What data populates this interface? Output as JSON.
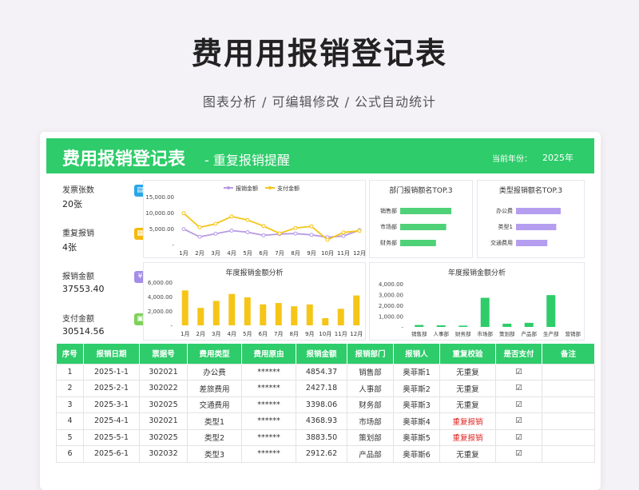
{
  "hero": {
    "title": "费用用报销登记表",
    "subtitle": "图表分析 /  可编辑修改  /  公式自动统计"
  },
  "header": {
    "title": "费用报销登记表",
    "subtitle": "- 重复报销提醒",
    "year_label": "当前年份：",
    "year_value": "2025年"
  },
  "kpis": [
    {
      "label": "发票张数",
      "value": "20张",
      "icon": "doc-icon",
      "color": "#29a6e8",
      "glyph": "▤"
    },
    {
      "label": "重复报销",
      "value": "4张",
      "icon": "repeat-icon",
      "color": "#f5b90f",
      "glyph": "▦"
    },
    {
      "label": "报销金额",
      "value": "37553.40",
      "icon": "yen-icon",
      "color": "#a48ee8",
      "glyph": "¥"
    },
    {
      "label": "支付金额",
      "value": "30514.56",
      "icon": "pay-icon",
      "color": "#7fd15a",
      "glyph": "▣"
    }
  ],
  "chart_data": [
    {
      "type": "line",
      "legend": [
        "报销金额",
        "支付金额"
      ],
      "categories": [
        "1月",
        "2月",
        "3月",
        "4月",
        "5月",
        "6月",
        "7月",
        "8月",
        "9月",
        "10月",
        "11月",
        "12月"
      ],
      "series": [
        {
          "name": "报销金额",
          "values": [
            4854,
            2428,
            3398,
            4369,
            3884,
            2913,
            3300,
            3450,
            3050,
            2300,
            2700,
            4500
          ],
          "color": "#b79ae3"
        },
        {
          "name": "支付金额",
          "values": [
            9800,
            5400,
            6500,
            8800,
            7700,
            5800,
            3500,
            5200,
            5700,
            1500,
            3800,
            4300
          ],
          "color": "#f5c518"
        }
      ],
      "yticks": [
        "15,000.00",
        "10,000.00",
        "5,000.00",
        "-"
      ],
      "ylim": [
        0,
        15000
      ]
    },
    {
      "type": "bar",
      "title": "年度报销金额分析",
      "categories": [
        "1月",
        "2月",
        "3月",
        "4月",
        "5月",
        "6月",
        "7月",
        "8月",
        "9月",
        "10月",
        "11月",
        "12月"
      ],
      "values": [
        4854,
        2428,
        3398,
        4369,
        3884,
        2913,
        3100,
        2650,
        2900,
        1000,
        2300,
        4150
      ],
      "yticks": [
        "6,000.00",
        "4,000.00",
        "2,000.00",
        "-"
      ],
      "ylim": [
        0,
        6000
      ],
      "color": "#f5c518"
    },
    {
      "type": "bar",
      "title": "部门报销额名TOP.3",
      "orientation": "horizontal",
      "categories": [
        "销售部",
        "市场部",
        "财务部"
      ],
      "values": [
        4854,
        4369,
        3398
      ],
      "color": "#4fd178"
    },
    {
      "type": "bar",
      "title": "类型报销额名TOP.3",
      "orientation": "horizontal",
      "categories": [
        "办公费",
        "类型1",
        "交通费用"
      ],
      "values": [
        4854,
        4369,
        3398
      ],
      "color": "#b59ef0"
    },
    {
      "type": "bar",
      "title": "年度报销金额分析",
      "categories": [
        "销售部",
        "人事部",
        "财务部",
        "市场部",
        "策划部",
        "产品部",
        "生产部",
        "营销部"
      ],
      "values": [
        180,
        150,
        120,
        2700,
        300,
        380,
        2950,
        0
      ],
      "yticks": [
        "4,000.00",
        "3,000.00",
        "2,000.00",
        "1,000.00",
        "-"
      ],
      "ylim": [
        0,
        4000
      ],
      "color": "#2ecc6a"
    }
  ],
  "table": {
    "headers": [
      "序号",
      "报销日期",
      "票据号",
      "费用类型",
      "费用原由",
      "报销金额",
      "报销部门",
      "报销人",
      "重复校验",
      "是否支付",
      "备注"
    ],
    "rows": [
      [
        "1",
        "2025-1-1",
        "302021",
        "办公费",
        "******",
        "4854.37",
        "销售部",
        "奥菲斯1",
        "无重复",
        "☑",
        ""
      ],
      [
        "2",
        "2025-2-1",
        "302022",
        "差旅费用",
        "******",
        "2427.18",
        "人事部",
        "奥菲斯2",
        "无重复",
        "☑",
        ""
      ],
      [
        "3",
        "2025-3-1",
        "302025",
        "交通费用",
        "******",
        "3398.06",
        "财务部",
        "奥菲斯3",
        "无重复",
        "☑",
        ""
      ],
      [
        "4",
        "2025-4-1",
        "302021",
        "类型1",
        "******",
        "4368.93",
        "市场部",
        "奥菲斯4",
        "重复报销",
        "☑",
        ""
      ],
      [
        "5",
        "2025-5-1",
        "302025",
        "类型2",
        "******",
        "3883.50",
        "策划部",
        "奥菲斯5",
        "重复报销",
        "☑",
        ""
      ],
      [
        "6",
        "2025-6-1",
        "302032",
        "类型3",
        "******",
        "2912.62",
        "产品部",
        "奥菲斯6",
        "无重复",
        "☑",
        ""
      ]
    ],
    "warn_text": "重复报销"
  }
}
